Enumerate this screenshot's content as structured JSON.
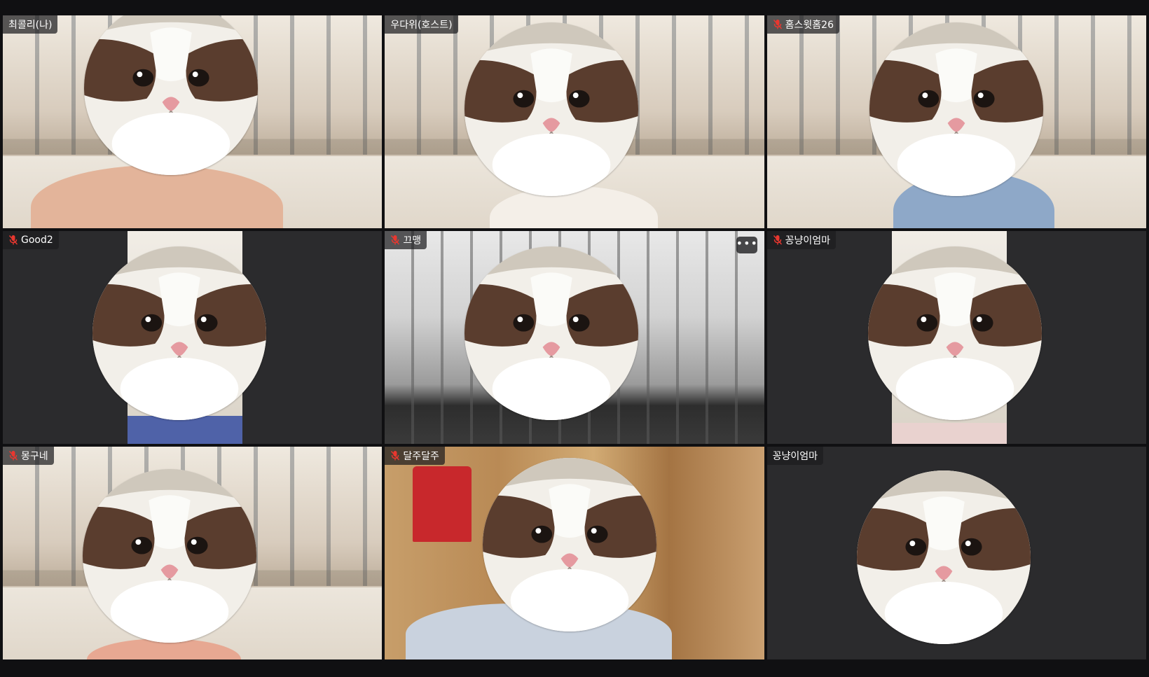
{
  "participants": [
    {
      "name": "최콜리(나)",
      "muted": false
    },
    {
      "name": "우다위(호스트)",
      "muted": false
    },
    {
      "name": "홈스윗홈26",
      "muted": true
    },
    {
      "name": "Good2",
      "muted": true
    },
    {
      "name": "끄맹",
      "muted": true
    },
    {
      "name": "꽁냥이엄마",
      "muted": true
    },
    {
      "name": "몽구네",
      "muted": true
    },
    {
      "name": "달주달주",
      "muted": true
    },
    {
      "name": "꽁냥이엄마",
      "muted": false
    }
  ],
  "tile_menu": {
    "label": "•••"
  },
  "colors": {
    "muted_mic": "#e8372f",
    "tag_bg": "#1c1c1e",
    "page_bg": "#101012"
  },
  "icons": {
    "muted": "mic-off-icon",
    "more": "more-options-icon",
    "avatar": "cat-face-avatar"
  }
}
